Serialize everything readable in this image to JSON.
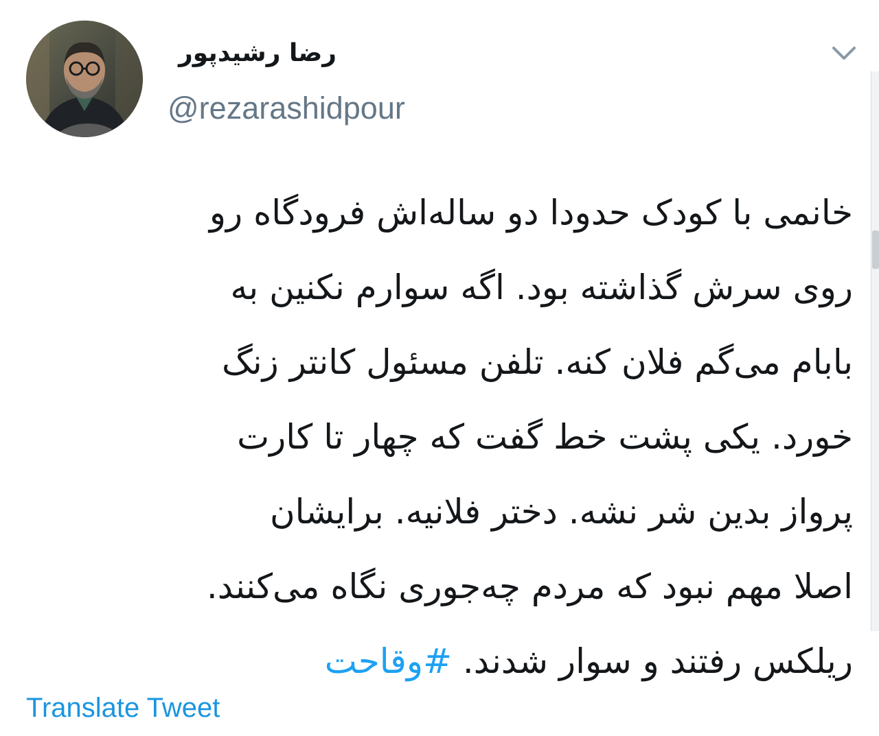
{
  "tweet": {
    "author": {
      "display_name": "رضا رشیدپور",
      "handle": "@rezarashidpour",
      "avatar_icon": "profile-photo"
    },
    "menu_icon": "chevron-down-icon",
    "body_lines": [
      "خانمی با کودک حدودا دو ساله‌اش فرودگاه رو",
      "روی سرش گذاشته بود. اگه سوارم نکنین به",
      "بابام می‌گم فلان کنه. تلفن مسئول کانتر زنگ",
      "خورد. یکی پشت خط گفت که چهار تا کارت",
      "پرواز بدین شر نشه. دختر فلانیه. برایشان",
      "اصلا مهم نبود که مردم چه‌جوری نگاه می‌کنند.",
      "ریلکس رفتند و سوار شدند."
    ],
    "hashtag": "#وقاحت",
    "translate_label": "Translate Tweet"
  },
  "colors": {
    "text_primary": "#14171a",
    "text_secondary": "#657786",
    "link": "#1da1f2",
    "translate_link": "#1b95e0",
    "background": "#ffffff"
  }
}
